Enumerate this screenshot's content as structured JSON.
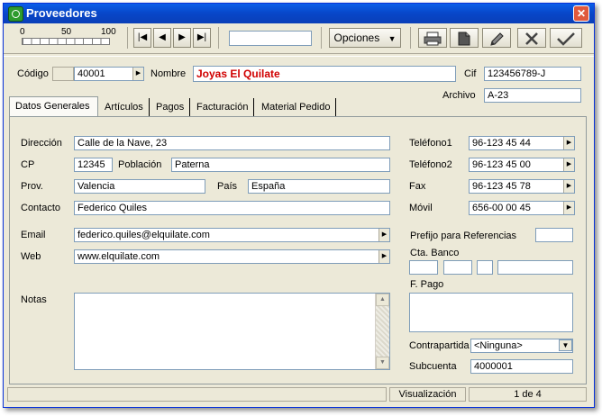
{
  "window": {
    "title": "Proveedores"
  },
  "toolbar": {
    "zoom_labels": [
      "0",
      "50",
      "100"
    ],
    "nav_first": "|◀",
    "nav_prev": "◀",
    "nav_next": "▶",
    "nav_last": "▶|",
    "search_value": "",
    "opciones_label": "Opciones",
    "opciones_arrow": "▼"
  },
  "header": {
    "codigo_label": "Código",
    "codigo_value": "40001",
    "nombre_label": "Nombre",
    "nombre_value": "Joyas El Quilate",
    "cif_label": "Cif",
    "cif_value": "123456789-J",
    "archivo_label": "Archivo",
    "archivo_value": "A-23"
  },
  "tabs": [
    "Datos Generales",
    "Artículos",
    "Pagos",
    "Facturación",
    "Material Pedido"
  ],
  "form": {
    "direccion_label": "Dirección",
    "direccion_value": "Calle de la Nave, 23",
    "cp_label": "CP",
    "cp_value": "12345",
    "poblacion_label": "Población",
    "poblacion_value": "Paterna",
    "prov_label": "Prov.",
    "prov_value": "Valencia",
    "pais_label": "País",
    "pais_value": "España",
    "contacto_label": "Contacto",
    "contacto_value": "Federico Quiles",
    "email_label": "Email",
    "email_value": "federico.quiles@elquilate.com",
    "web_label": "Web",
    "web_value": "www.elquilate.com",
    "notas_label": "Notas",
    "notas_value": "",
    "telefono1_label": "Teléfono1",
    "telefono1_value": "96-123 45 44",
    "telefono2_label": "Teléfono2",
    "telefono2_value": "96-123 45 00",
    "fax_label": "Fax",
    "fax_value": "96-123 45 78",
    "movil_label": "Móvil",
    "movil_value": "656-00 00 45",
    "prefijo_label": "Prefijo para Referencias",
    "prefijo_value": "",
    "cta_banco_label": "Cta. Banco",
    "cta_banco_values": [
      "",
      "",
      "",
      ""
    ],
    "fpago_label": "F. Pago",
    "fpago_value": "",
    "contrapartida_label": "Contrapartida",
    "contrapartida_value": "<Ninguna>",
    "subcuenta_label": "Subcuenta",
    "subcuenta_value": "4000001"
  },
  "status": {
    "left": "",
    "mode": "Visualización",
    "record": "1 de 4"
  }
}
